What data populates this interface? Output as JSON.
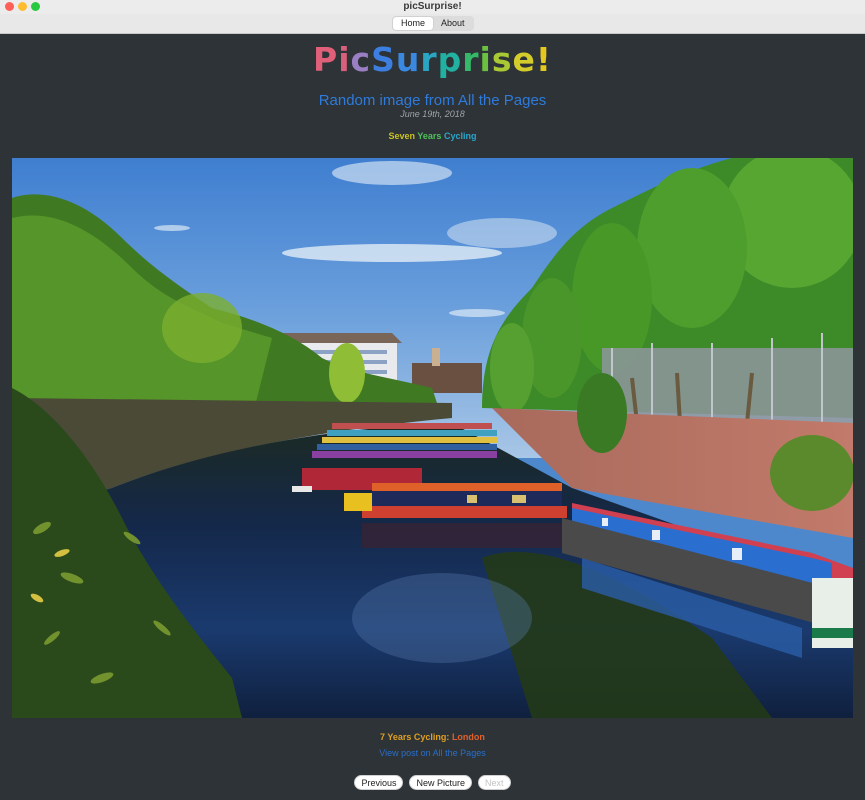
{
  "window": {
    "title": "picSurprise!",
    "tabs": [
      {
        "label": "Home",
        "active": true
      },
      {
        "label": "About",
        "active": false
      }
    ]
  },
  "logo": {
    "text": "PicSurprise!",
    "letters": [
      {
        "ch": "P",
        "color": "#e0607a"
      },
      {
        "ch": "i",
        "color": "#d8607c"
      },
      {
        "ch": "c",
        "color": "#9b7fc4"
      },
      {
        "ch": "S",
        "color": "#3d7fe0"
      },
      {
        "ch": "u",
        "color": "#3a88e0"
      },
      {
        "ch": "r",
        "color": "#2aa6c4"
      },
      {
        "ch": "p",
        "color": "#22b0a0"
      },
      {
        "ch": "r",
        "color": "#35b86a"
      },
      {
        "ch": "i",
        "color": "#6cc040"
      },
      {
        "ch": "s",
        "color": "#a8c834"
      },
      {
        "ch": "e",
        "color": "#d4cc2a"
      },
      {
        "ch": "!",
        "color": "#e4c820"
      }
    ]
  },
  "header": {
    "subtitle": "Random image from All the Pages",
    "date": "June 19th, 2018",
    "series": {
      "word1": "Seven",
      "word2": "Years",
      "word3": "Cycling"
    }
  },
  "photo": {
    "alt": "Canal with colourful narrowboats moored under a row of trees, London",
    "scene": "canal-narrowboats-london"
  },
  "footer": {
    "caption_prefix": "7 Years Cycling:",
    "caption_place": "London",
    "post_link": "View post on All the Pages"
  },
  "nav": {
    "previous": "Previous",
    "new_picture": "New Picture",
    "next": "Next",
    "next_enabled": false
  },
  "colors": {
    "background": "#2d3337",
    "accent_blue": "#2e7bdc",
    "caption_orange": "#e0a020",
    "caption_red": "#e0602a"
  }
}
